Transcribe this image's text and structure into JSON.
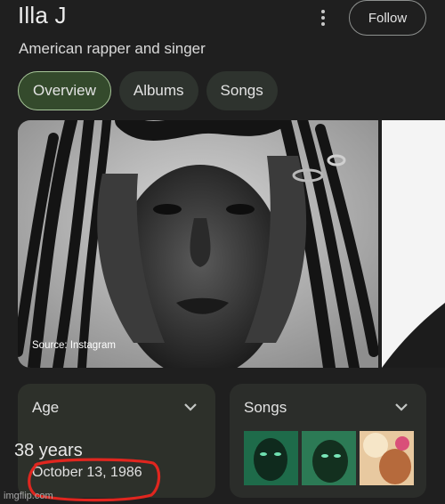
{
  "header": {
    "title": "Illa J",
    "more_icon": "more-vert-icon",
    "follow_label": "Follow",
    "subtitle": "American rapper and singer"
  },
  "tabs": [
    {
      "label": "Overview",
      "active": true
    },
    {
      "label": "Albums",
      "active": false
    },
    {
      "label": "Songs",
      "active": false
    }
  ],
  "hero": {
    "source_caption": "Source: Instagram"
  },
  "cards": {
    "age": {
      "label": "Age",
      "value": "38 years",
      "birth_date": "October 13, 1986"
    },
    "songs": {
      "label": "Songs",
      "thumbnails": [
        "song-thumb-green",
        "song-thumb-green",
        "song-thumb-warm"
      ]
    }
  },
  "watermark": "imgflip.com",
  "colors": {
    "background": "#1f1f1f",
    "active_tab_bg": "#344a2c",
    "active_tab_border": "#a8c79a",
    "annotation_red": "#e0261f"
  }
}
